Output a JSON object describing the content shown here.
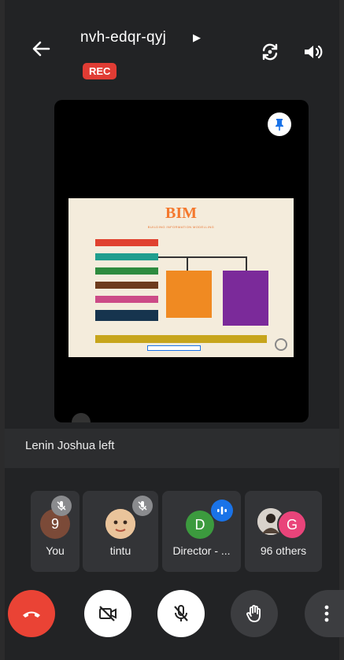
{
  "meeting": {
    "code": "nvh-edqr-qyj",
    "recording_badge": "REC"
  },
  "header": {
    "back_icon": "arrow-left-icon",
    "switch_camera_icon": "camera-switch-icon",
    "audio_icon": "speaker-icon"
  },
  "presentation": {
    "slide_title": "BIM",
    "slide_subtitle": "BUILDING INFORMATION MODELLING",
    "pin_icon": "pin-icon"
  },
  "notification": {
    "text": "Lenin Joshua left"
  },
  "participants": [
    {
      "label": "You",
      "initial": "9",
      "muted": true
    },
    {
      "label": "tintu",
      "muted": true
    },
    {
      "label": "Director - ...",
      "initial": "D",
      "speaking": true
    },
    {
      "label": "96 others",
      "initial": "G"
    }
  ],
  "controls": {
    "end_call_icon": "phone-hangup-icon",
    "camera_icon": "camera-off-icon",
    "mic_icon": "mic-off-icon",
    "raise_hand_icon": "hand-icon",
    "more_icon": "more-vertical-icon"
  },
  "colors": {
    "rec_red": "#e13c34",
    "end_call_red": "#ea4335",
    "avatar_green": "#3c9a3e",
    "avatar_pink": "#e9447a",
    "speaking_blue": "#1a73e8"
  }
}
